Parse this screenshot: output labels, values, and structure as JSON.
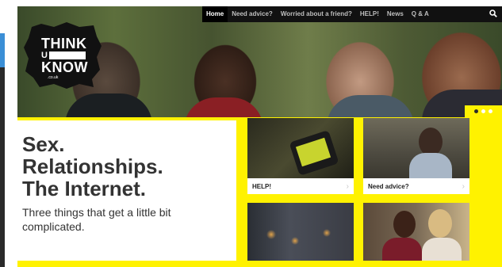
{
  "nav": {
    "items": [
      "Home",
      "Need advice?",
      "Worried about a friend?",
      "HELP!",
      "News",
      "Q & A"
    ],
    "active": "Home",
    "search_icon": "search-icon"
  },
  "logo": {
    "line1": "THINK",
    "line2": "U",
    "line3": "KNOW",
    "line4": ".co.uk"
  },
  "carousel": {
    "dots": 3,
    "active_index": 0
  },
  "hero": {
    "headline": [
      "Sex.",
      "Relationships.",
      "The Internet."
    ],
    "subtext": "Three things that get a little bit complicated."
  },
  "tiles": [
    {
      "label": "HELP!",
      "arrow": "›"
    },
    {
      "label": "Need advice?",
      "arrow": "›"
    },
    {
      "label": "",
      "arrow": ""
    },
    {
      "label": "",
      "arrow": ""
    }
  ],
  "colors": {
    "accent_yellow": "#fff200",
    "nav_bg": "#111111",
    "text_dark": "#333333"
  }
}
